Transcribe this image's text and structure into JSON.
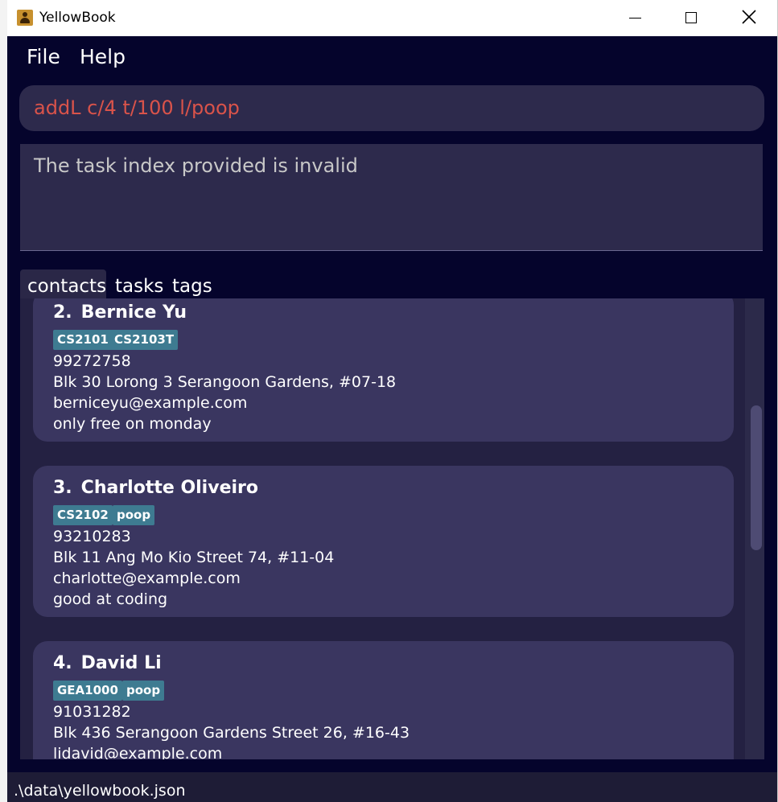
{
  "window": {
    "title": "YellowBook"
  },
  "menu": {
    "file": "File",
    "help": "Help"
  },
  "command": {
    "value": "addL c/4 t/100 l/poop"
  },
  "result": {
    "message": "The task index provided is invalid"
  },
  "tabs": {
    "contacts": "contacts",
    "tasks": "tasks",
    "tags": "tags"
  },
  "contacts": [
    {
      "index": "2.",
      "name": "Bernice Yu",
      "tags": [
        "CS2101",
        "CS2103T"
      ],
      "phone": "99272758",
      "address": "Blk 30 Lorong 3 Serangoon Gardens, #07-18",
      "email": "berniceyu@example.com",
      "remark": "only free on monday"
    },
    {
      "index": "3.",
      "name": "Charlotte Oliveiro",
      "tags": [
        "CS2102",
        "poop"
      ],
      "phone": "93210283",
      "address": "Blk 11 Ang Mo Kio Street 74, #11-04",
      "email": "charlotte@example.com",
      "remark": "good at coding"
    },
    {
      "index": "4.",
      "name": "David Li",
      "tags": [
        "GEA1000",
        "poop"
      ],
      "phone": "91031282",
      "address": "Blk 436 Serangoon Gardens Street 26, #16-43",
      "email": "lidavid@example.com"
    }
  ],
  "status": {
    "file_path": ".\\data\\yellowbook.json"
  },
  "colors": {
    "background": "#05042c",
    "panel": "#2d2a4c",
    "card": "#3a3660",
    "tag": "#3e7b91",
    "error_text": "#d9534a"
  }
}
